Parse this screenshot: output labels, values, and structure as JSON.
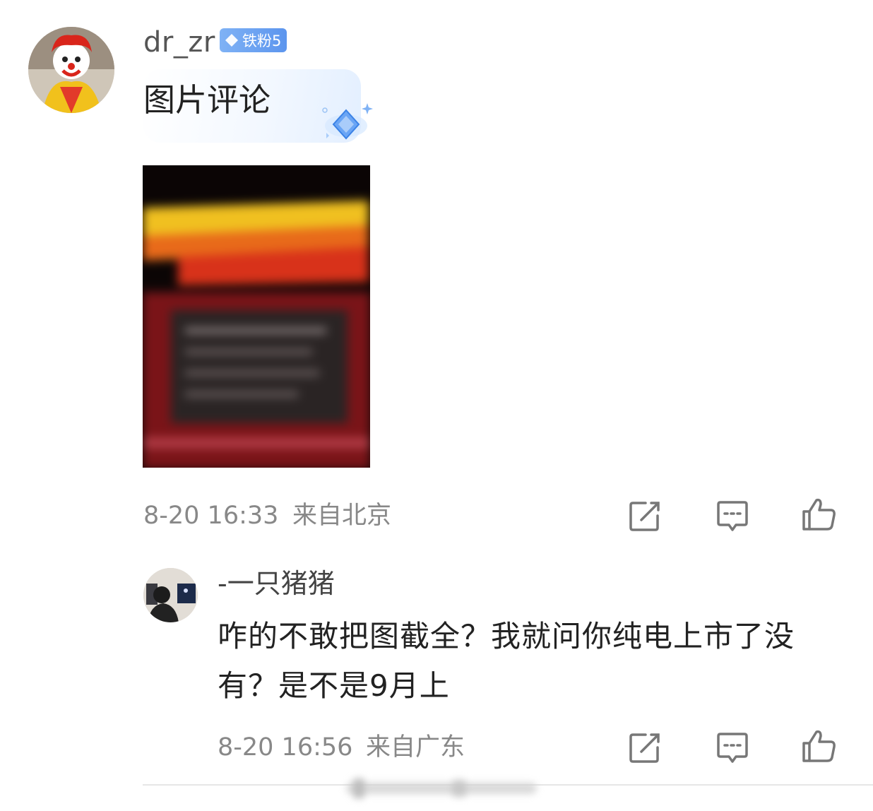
{
  "comment": {
    "username": "dr_zr",
    "badge_label": "铁粉5",
    "text": "图片评论",
    "time": "8-20 16:33",
    "location": "来自北京"
  },
  "reply": {
    "username": "-一只猪猪",
    "text": "咋的不敢把图截全？我就问你纯电上市了没有？是不是9月上",
    "time": "8-20 16:56",
    "location": "来自广东"
  },
  "icons": {
    "share": "share-icon",
    "comment": "comment-icon",
    "like": "thumbs-up-icon"
  },
  "colors": {
    "badge": "#6ea6f3",
    "meta_text": "#888888",
    "icon_stroke": "#777777"
  }
}
